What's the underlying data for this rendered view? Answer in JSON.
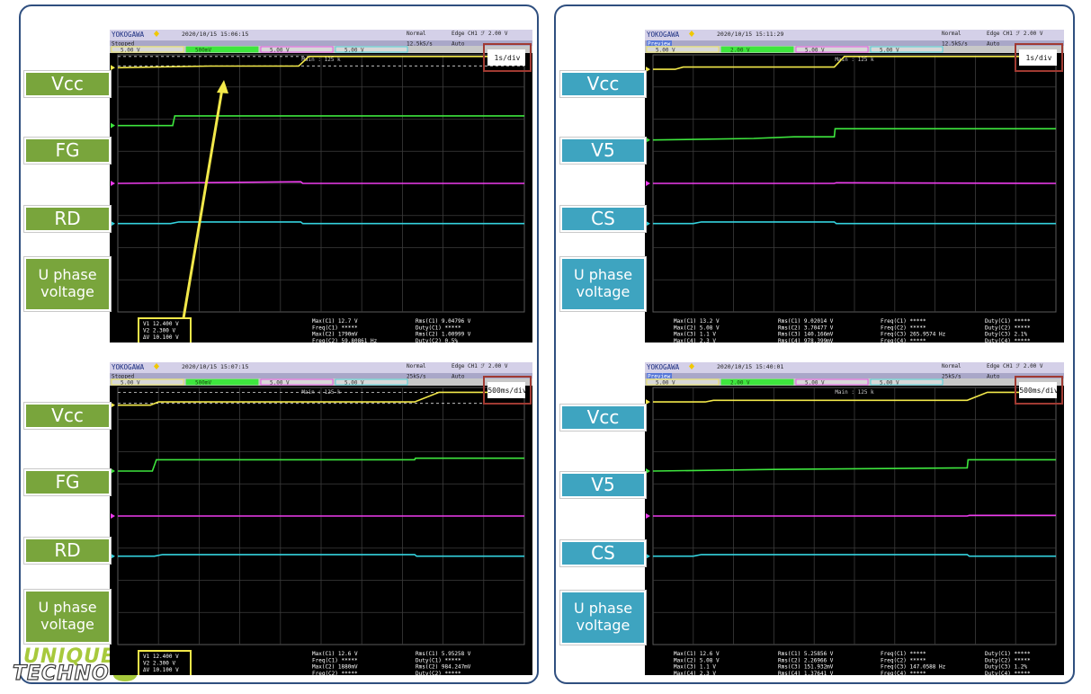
{
  "colors": {
    "ch1": "#f2e84a",
    "ch2": "#3ee63e",
    "ch3": "#ee3cee",
    "ch4": "#34d2de",
    "label_green": "#79a53c",
    "label_blue": "#3ea4c0",
    "panel_border": "#2f4f7f",
    "scope_bg": "#000000",
    "highlight_box": "#f2e84a",
    "timebase_box": "#a03a32"
  },
  "logo": {
    "line1": "UNIQUE",
    "line2": "TECHNO"
  },
  "scopes": [
    {
      "brand": "YOKOGAWA",
      "status": "Stopped",
      "datetime": "2020/10/15 15:06:15",
      "mode": "Normal",
      "sample_rate": "12.5kS/s",
      "trigger": "Edge CH1 ℱ 2.00 V",
      "trigger_mode": "Auto",
      "channels": [
        "5.00 V",
        "500mV",
        "5.00 V",
        "5.00 V"
      ],
      "memory": "Main : 125 k",
      "timebase": "1s/div",
      "labels": [
        "Vcc",
        "FG",
        "RD",
        "U phase\nvoltage"
      ],
      "label_style": "green",
      "cursor": [
        "V1   12.400 V",
        "V2   2.300 V",
        "ΔV   10.100 V"
      ],
      "measurements": [
        [
          "Max(C1)  12.7 V",
          "Freq(C1)  *****",
          "Max(C2)  1790mV",
          "Freq(C2)  59.80861 Hz"
        ],
        [
          "Rms(C1)  9.04796 V",
          "Duty(C1)  *****",
          "Rms(C2)  1.00999 V",
          "Duty(C2)  0.5%"
        ]
      ]
    },
    {
      "brand": "YOKOGAWA",
      "status": "Preview",
      "datetime": "2020/10/15 15:11:29",
      "mode": "Normal",
      "sample_rate": "12.5kS/s",
      "trigger": "Edge CH1 ℱ 2.00 V",
      "trigger_mode": "Auto",
      "channels": [
        "5.00 V",
        "2.00 V",
        "5.00 V",
        "5.00 V"
      ],
      "memory": "Main : 125 k",
      "timebase": "1s/div",
      "labels": [
        "Vcc",
        "V5",
        "CS",
        "U phase\nvoltage"
      ],
      "label_style": "blue",
      "cursor": [],
      "measurements": [
        [
          "Max(C1)  13.2 V",
          "Max(C2)  5.08 V",
          "Max(C3)  1.1 V",
          "Max(C4)  2.3 V"
        ],
        [
          "Rms(C1)  9.02014 V",
          "Rms(C2)  3.70477 V",
          "Rms(C3)  140.166mV",
          "Rms(C4)  978.399mV"
        ],
        [
          "Freq(C1)  *****",
          "Freq(C2)  *****",
          "Freq(C3)  265.9574 Hz",
          "Freq(C4)  *****"
        ],
        [
          "Duty(C1)  *****",
          "Duty(C2)  *****",
          "Duty(C3)  2.1%",
          "Duty(C4)  *****"
        ]
      ]
    },
    {
      "brand": "YOKOGAWA",
      "status": "Stopped",
      "datetime": "2020/10/15 15:07:15",
      "mode": "Normal",
      "sample_rate": "25kS/s",
      "trigger": "Edge CH1 ℱ 2.00 V",
      "trigger_mode": "Auto",
      "channels": [
        "5.00 V",
        "500mV",
        "5.00 V",
        "5.00 V"
      ],
      "memory": "Main : 125 k",
      "timebase": "500ms/div",
      "labels": [
        "Vcc",
        "FG",
        "RD",
        "U phase\nvoltage"
      ],
      "label_style": "green",
      "cursor": [
        "V1   12.400 V",
        "V2   2.300 V",
        "ΔV   10.100 V"
      ],
      "measurements": [
        [
          "Max(C1)  12.6 V",
          "Freq(C1)  *****",
          "Max(C2)  1880mV",
          "Freq(C2)  *****"
        ],
        [
          "Rms(C1)  5.95258 V",
          "Duty(C1)  *****",
          "Rms(C2)  984.247mV",
          "Duty(C2)  *****"
        ]
      ]
    },
    {
      "brand": "YOKOGAWA",
      "status": "Preview",
      "datetime": "2020/10/15 15:40:01",
      "mode": "Normal",
      "sample_rate": "25kS/s",
      "trigger": "Edge CH1 ℱ 2.00 V",
      "trigger_mode": "Auto",
      "channels": [
        "5.00 V",
        "2.00 V",
        "5.00 V",
        "5.00 V"
      ],
      "memory": "Main : 125 k",
      "timebase": "500ms/div",
      "labels": [
        "Vcc",
        "V5",
        "CS",
        "U phase\nvoltage"
      ],
      "label_style": "blue",
      "cursor": [],
      "measurements": [
        [
          "Max(C1)  12.6 V",
          "Max(C2)  5.08 V",
          "Max(C3)  1.1 V",
          "Max(C4)  2.3 V"
        ],
        [
          "Rms(C1)  5.25856 V",
          "Rms(C2)  2.26966 V",
          "Rms(C3)  151.932mV",
          "Rms(C4)  1.37641 V"
        ],
        [
          "Freq(C1)  *****",
          "Freq(C2)  *****",
          "Freq(C3)  147.0588 Hz",
          "Freq(C4)  *****"
        ],
        [
          "Duty(C1)  *****",
          "Duty(C2)  *****",
          "Duty(C3)  1.2%",
          "Duty(C4)  *****"
        ]
      ]
    }
  ],
  "chart_data": [
    {
      "type": "line",
      "title": "",
      "x_unit": "div",
      "y_unit": "div",
      "xlim": [
        0,
        10
      ],
      "ylim": [
        -4,
        4
      ],
      "timebase": "1s/div",
      "grid": true,
      "series": [
        {
          "name": "Vcc",
          "color": "#f2e84a",
          "x": [
            0,
            2.25,
            4.45,
            4.7,
            10
          ],
          "y": [
            3.6,
            3.65,
            3.65,
            3.95,
            3.95
          ]
        },
        {
          "name": "FG",
          "color": "#3ee63e",
          "x": [
            0,
            1.35,
            1.4,
            4.5,
            10
          ],
          "y": [
            1.8,
            1.8,
            2.1,
            2.1,
            2.1
          ]
        },
        {
          "name": "RD",
          "color": "#ee3cee",
          "x": [
            0,
            4.5,
            4.55,
            10
          ],
          "y": [
            0.0,
            0.05,
            0.0,
            0.0
          ]
        },
        {
          "name": "U phase voltage",
          "color": "#34d2de",
          "x": [
            0,
            1.3,
            1.5,
            4.5,
            4.55,
            10
          ],
          "y": [
            -1.25,
            -1.25,
            -1.2,
            -1.2,
            -1.25,
            -1.25
          ]
        }
      ]
    },
    {
      "type": "line",
      "title": "",
      "x_unit": "div",
      "y_unit": "div",
      "xlim": [
        0,
        10
      ],
      "ylim": [
        -4,
        4
      ],
      "timebase": "1s/div",
      "grid": true,
      "series": [
        {
          "name": "Vcc",
          "color": "#f2e84a",
          "x": [
            0,
            0.55,
            0.75,
            4.5,
            4.75,
            10
          ],
          "y": [
            3.55,
            3.55,
            3.62,
            3.62,
            3.95,
            3.95
          ]
        },
        {
          "name": "V5",
          "color": "#3ee63e",
          "x": [
            0,
            2.5,
            3.5,
            4.5,
            4.52,
            10
          ],
          "y": [
            1.35,
            1.4,
            1.45,
            1.45,
            1.7,
            1.7
          ]
        },
        {
          "name": "CS",
          "color": "#ee3cee",
          "x": [
            0,
            4.5,
            4.55,
            10
          ],
          "y": [
            0.0,
            0.0,
            0.02,
            0.0
          ]
        },
        {
          "name": "U phase voltage",
          "color": "#34d2de",
          "x": [
            0,
            1.0,
            1.2,
            4.5,
            4.55,
            10
          ],
          "y": [
            -1.25,
            -1.25,
            -1.2,
            -1.2,
            -1.25,
            -1.25
          ]
        }
      ]
    },
    {
      "type": "line",
      "title": "",
      "x_unit": "div",
      "y_unit": "div",
      "xlim": [
        0,
        10
      ],
      "ylim": [
        -4,
        4
      ],
      "timebase": "500ms/div",
      "grid": true,
      "series": [
        {
          "name": "Vcc",
          "color": "#f2e84a",
          "x": [
            0,
            0.8,
            1.0,
            7.3,
            7.9,
            10
          ],
          "y": [
            3.45,
            3.45,
            3.55,
            3.55,
            3.85,
            3.85
          ]
        },
        {
          "name": "FG",
          "color": "#3ee63e",
          "x": [
            0,
            0.85,
            0.95,
            7.3,
            7.32,
            10
          ],
          "y": [
            1.4,
            1.4,
            1.75,
            1.75,
            1.8,
            1.8
          ]
        },
        {
          "name": "RD",
          "color": "#ee3cee",
          "x": [
            0,
            10
          ],
          "y": [
            0.0,
            0.0
          ]
        },
        {
          "name": "U phase voltage",
          "color": "#34d2de",
          "x": [
            0,
            0.9,
            1.1,
            7.3,
            7.35,
            10
          ],
          "y": [
            -1.25,
            -1.25,
            -1.2,
            -1.2,
            -1.25,
            -1.25
          ]
        }
      ]
    },
    {
      "type": "line",
      "title": "",
      "x_unit": "div",
      "y_unit": "div",
      "xlim": [
        0,
        10
      ],
      "ylim": [
        -4,
        4
      ],
      "timebase": "500ms/div",
      "grid": true,
      "series": [
        {
          "name": "Vcc",
          "color": "#f2e84a",
          "x": [
            0,
            1.3,
            1.5,
            7.8,
            8.3,
            10
          ],
          "y": [
            3.55,
            3.55,
            3.6,
            3.6,
            3.85,
            3.85
          ]
        },
        {
          "name": "V5",
          "color": "#3ee63e",
          "x": [
            0,
            3.0,
            7.8,
            7.82,
            10
          ],
          "y": [
            1.4,
            1.45,
            1.5,
            1.75,
            1.75
          ]
        },
        {
          "name": "CS",
          "color": "#ee3cee",
          "x": [
            0,
            7.8,
            7.85,
            10
          ],
          "y": [
            0.0,
            0.0,
            0.02,
            0.02
          ]
        },
        {
          "name": "U phase voltage",
          "color": "#34d2de",
          "x": [
            0,
            1.0,
            1.2,
            7.8,
            7.85,
            10
          ],
          "y": [
            -1.25,
            -1.25,
            -1.2,
            -1.2,
            -1.25,
            -1.25
          ]
        }
      ]
    }
  ]
}
